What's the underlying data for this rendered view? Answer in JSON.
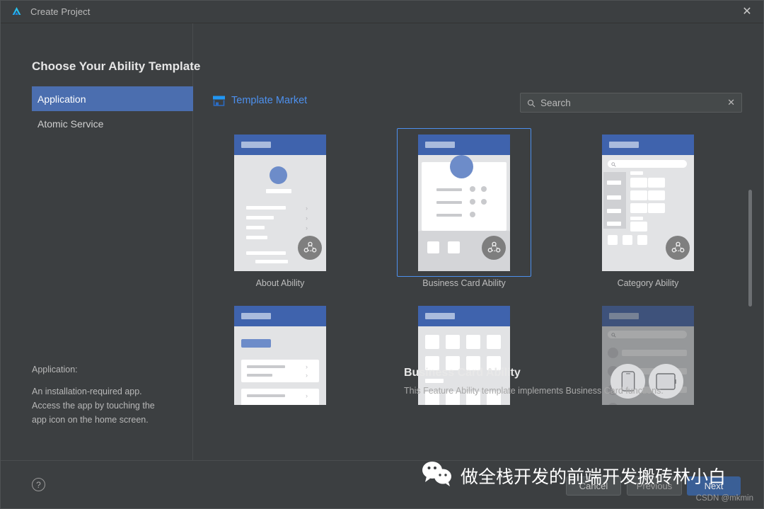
{
  "window": {
    "title": "Create Project",
    "logo_icon": "deveco-logo-icon",
    "close_icon": "close-icon"
  },
  "sidebar": {
    "heading": "Choose Your Ability Template",
    "items": [
      {
        "label": "Application",
        "selected": true
      },
      {
        "label": "Atomic Service",
        "selected": false
      }
    ],
    "description_title": "Application:",
    "description_lines": [
      "An installation-required app.",
      "Access the app by touching the",
      "app icon on the home screen."
    ]
  },
  "main": {
    "template_market_label": "Template Market",
    "template_market_icon": "shop-icon",
    "search": {
      "placeholder": "Search",
      "value": "",
      "icon": "search-icon",
      "clear_icon": "close-icon"
    },
    "templates": [
      {
        "label": "About Ability",
        "selected": false,
        "disabled": false,
        "variant": "about"
      },
      {
        "label": "Business Card Ability",
        "selected": true,
        "disabled": false,
        "variant": "business-card"
      },
      {
        "label": "Category Ability",
        "selected": false,
        "disabled": false,
        "variant": "category"
      },
      {
        "label": "",
        "selected": false,
        "disabled": false,
        "variant": "list"
      },
      {
        "label": "",
        "selected": false,
        "disabled": false,
        "variant": "grid"
      },
      {
        "label": "",
        "selected": false,
        "disabled": true,
        "variant": "devices"
      }
    ],
    "selected_title": "Business Card Ability",
    "selected_description": "This Feature Ability template implements Business Card functions.",
    "scrollbar": {
      "visible": true
    }
  },
  "footer": {
    "help_icon": "help-icon",
    "help_label": "?",
    "cancel_label": "Cancel",
    "previous_label": "Previous",
    "next_label": "Next"
  },
  "watermark": {
    "wechat_icon": "wechat-icon",
    "text": "做全栈开发的前端开发搬砖林小白",
    "credit": "CSDN @mkmin"
  },
  "colors": {
    "accent_blue": "#4d90ee",
    "selection_blue": "#4b6eaf",
    "primary_button": "#3a5f96",
    "window_bg": "#3c3f41",
    "mock_header": "#3f63ad"
  }
}
